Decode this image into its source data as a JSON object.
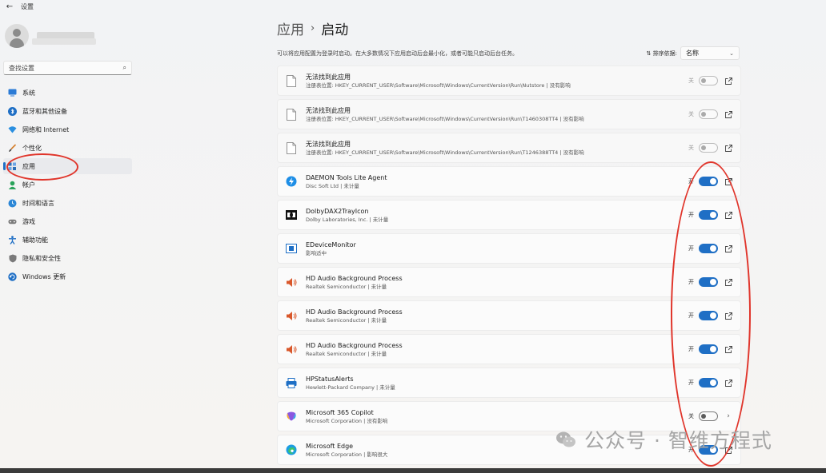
{
  "window": {
    "title": "设置",
    "back_glyph": "←"
  },
  "sidebar": {
    "search_placeholder": "查找设置",
    "items": [
      {
        "label": "系统",
        "icon": "monitor-icon",
        "color": "#2b7bd6"
      },
      {
        "label": "蓝牙和其他设备",
        "icon": "bluetooth-icon",
        "color": "#1f6fc5"
      },
      {
        "label": "网络和 Internet",
        "icon": "wifi-icon",
        "color": "#2b8fe0"
      },
      {
        "label": "个性化",
        "icon": "brush-icon",
        "color": "#d57f2a"
      },
      {
        "label": "应用",
        "icon": "apps-icon",
        "color": "#2b6fb8",
        "active": true
      },
      {
        "label": "帐户",
        "icon": "account-icon",
        "color": "#2aa35a"
      },
      {
        "label": "时间和语言",
        "icon": "globe-clock-icon",
        "color": "#2b86d6"
      },
      {
        "label": "游戏",
        "icon": "gamepad-icon",
        "color": "#7a7a7a"
      },
      {
        "label": "辅助功能",
        "icon": "accessibility-icon",
        "color": "#1f6fc5"
      },
      {
        "label": "隐私和安全性",
        "icon": "shield-icon",
        "color": "#7a7a7a"
      },
      {
        "label": "Windows 更新",
        "icon": "update-icon",
        "color": "#1f6fc5"
      }
    ]
  },
  "main": {
    "breadcrumb_parent": "应用",
    "breadcrumb_sep": "›",
    "breadcrumb_current": "启动",
    "description": "可以将应用配置为登录时启动。在大多数情况下应用启动后会最小化，或者可能只启动后台任务。",
    "sort_label": "排序依据:",
    "sort_glyph": "⇅",
    "sort_value": "名称",
    "rows": [
      {
        "name": "无法找到此应用",
        "sub": "注册表位置: HKEY_CURRENT_USER\\Software\\Microsoft\\Windows\\CurrentVersion\\Run\\Nutstore  |  没有影响",
        "state": "关",
        "on": false,
        "dim": true,
        "icon": "file-icon",
        "action": "ext"
      },
      {
        "name": "无法找到此应用",
        "sub": "注册表位置: HKEY_CURRENT_USER\\Software\\Microsoft\\Windows\\CurrentVersion\\Run\\T1460308TT4  |  没有影响",
        "state": "关",
        "on": false,
        "dim": true,
        "icon": "file-icon",
        "action": "ext"
      },
      {
        "name": "无法找到此应用",
        "sub": "注册表位置: HKEY_CURRENT_USER\\Software\\Microsoft\\Windows\\CurrentVersion\\Run\\T1246388TT4  |  没有影响",
        "state": "关",
        "on": false,
        "dim": true,
        "icon": "file-icon",
        "action": "ext"
      },
      {
        "name": "DAEMON Tools Lite Agent",
        "sub": "Disc Soft Ltd  |  未计量",
        "state": "开",
        "on": true,
        "dim": false,
        "icon": "daemon-tools-icon",
        "action": "ext"
      },
      {
        "name": "DolbyDAX2TrayIcon",
        "sub": "Dolby Laboratories, Inc.  |  未计量",
        "state": "开",
        "on": true,
        "dim": false,
        "icon": "dolby-icon",
        "action": "ext"
      },
      {
        "name": "EDeviceMonitor",
        "sub": "影响适中",
        "state": "开",
        "on": true,
        "dim": false,
        "icon": "device-monitor-icon",
        "action": "ext"
      },
      {
        "name": "HD Audio Background Process",
        "sub": "Realtek Semiconductor  |  未计量",
        "state": "开",
        "on": true,
        "dim": false,
        "icon": "speaker-icon",
        "action": "ext"
      },
      {
        "name": "HD Audio Background Process",
        "sub": "Realtek Semiconductor  |  未计量",
        "state": "开",
        "on": true,
        "dim": false,
        "icon": "speaker-icon",
        "action": "ext"
      },
      {
        "name": "HD Audio Background Process",
        "sub": "Realtek Semiconductor  |  未计量",
        "state": "开",
        "on": true,
        "dim": false,
        "icon": "speaker-icon",
        "action": "ext"
      },
      {
        "name": "HPStatusAlerts",
        "sub": "Hewlett-Packard Company  |  未计量",
        "state": "开",
        "on": true,
        "dim": false,
        "icon": "printer-icon",
        "action": "ext"
      },
      {
        "name": "Microsoft 365 Copilot",
        "sub": "Microsoft Corporation  |  没有影响",
        "state": "关",
        "on": false,
        "dim": false,
        "icon": "copilot-icon",
        "action": "chevron"
      },
      {
        "name": "Microsoft Edge",
        "sub": "Microsoft Corporation  |  影响很大",
        "state": "开",
        "on": true,
        "dim": false,
        "icon": "edge-icon",
        "action": "ext"
      }
    ]
  },
  "watermark": {
    "text": "公众号 · 智维方程式"
  },
  "colors": {
    "accent": "#1f6fc5",
    "annotation": "#e0352b"
  }
}
